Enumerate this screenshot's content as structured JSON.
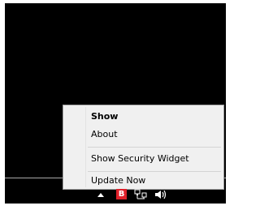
{
  "context_menu": {
    "items": [
      {
        "label": "Show",
        "bold": true
      },
      {
        "label": "About",
        "bold": false
      },
      {
        "label": "Show Security Widget",
        "bold": false
      },
      {
        "label": "Update Now",
        "bold": false
      }
    ]
  },
  "tray": {
    "icons": [
      {
        "name": "show-hidden-icons-arrow",
        "glyph": "▲"
      },
      {
        "name": "security-app-icon",
        "glyph": "B",
        "color": "#e0202a"
      },
      {
        "name": "network-icon"
      },
      {
        "name": "speaker-icon"
      }
    ]
  },
  "colors": {
    "desktop": "#000000",
    "menu_background": "#f0f0f0",
    "menu_border": "#a0a0a0",
    "brand_red": "#e0202a"
  }
}
